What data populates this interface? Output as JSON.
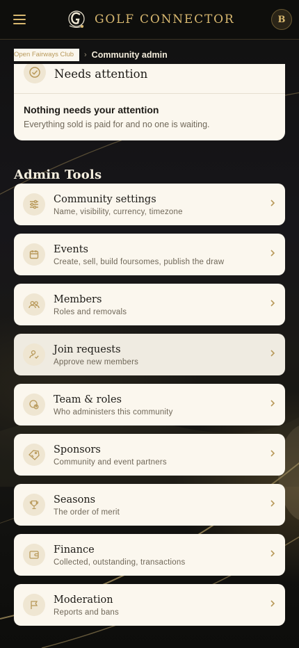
{
  "header": {
    "brand_first": "Golf",
    "brand_second": "Connector",
    "avatar_initial": "B"
  },
  "breadcrumb": {
    "parent": "Open Fairways Club",
    "separator": "›",
    "current": "Community admin"
  },
  "attention": {
    "title": "Needs attention",
    "empty_title": "Nothing needs your attention",
    "empty_subtitle": "Everything sold is paid for and no one is waiting."
  },
  "admin_tools": {
    "title": "Admin Tools",
    "items": [
      {
        "title": "Community settings",
        "subtitle": "Name, visibility, currency, timezone",
        "icon": "sliders-icon"
      },
      {
        "title": "Events",
        "subtitle": "Create, sell, build foursomes, publish the draw",
        "icon": "calendar-icon"
      },
      {
        "title": "Members",
        "subtitle": "Roles and removals",
        "icon": "people-icon"
      },
      {
        "title": "Join requests",
        "subtitle": "Approve new members",
        "icon": "user-check-icon"
      },
      {
        "title": "Team & roles",
        "subtitle": "Who administers this community",
        "icon": "shield-user-icon"
      },
      {
        "title": "Sponsors",
        "subtitle": "Community and event partners",
        "icon": "tag-icon"
      },
      {
        "title": "Seasons",
        "subtitle": "The order of merit",
        "icon": "trophy-icon"
      },
      {
        "title": "Finance",
        "subtitle": "Collected, outstanding, transactions",
        "icon": "wallet-icon"
      },
      {
        "title": "Moderation",
        "subtitle": "Reports and bans",
        "icon": "flag-icon"
      }
    ]
  },
  "colors": {
    "accent_gold": "#d8b870",
    "card_bg": "#fbf7ee",
    "icon_bg": "#efe6d2",
    "page_bg": "#0f0f0d"
  }
}
